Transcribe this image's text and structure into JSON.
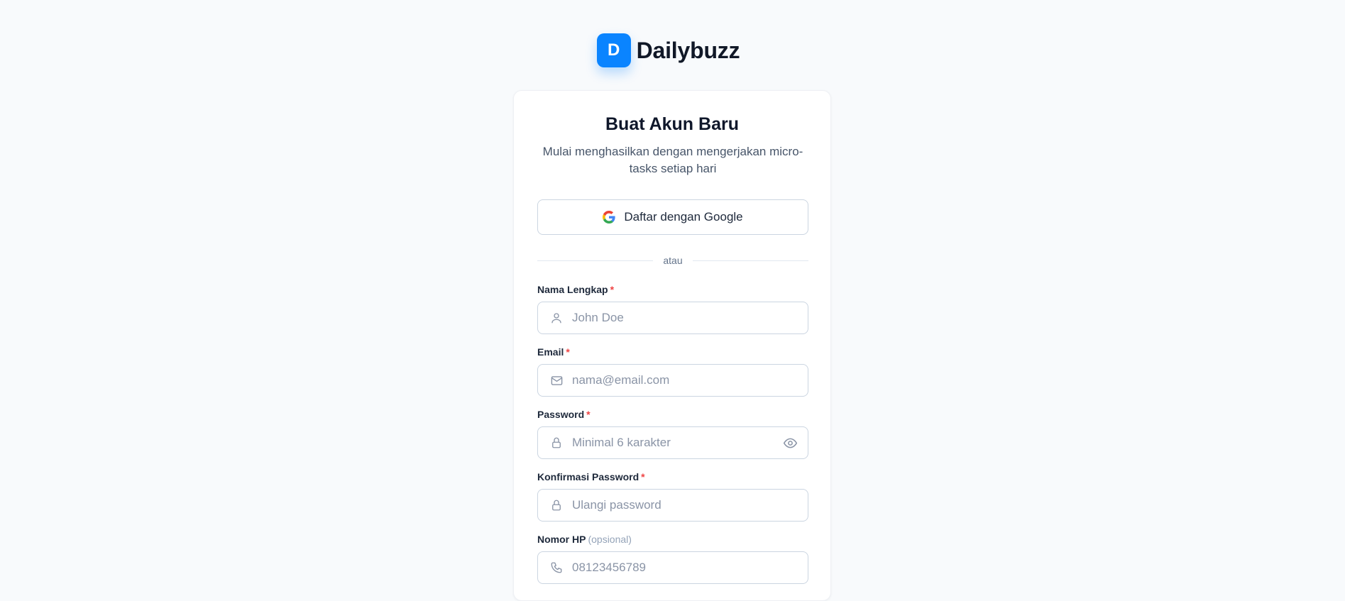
{
  "brand": {
    "logo_letter": "D",
    "name": "Dailybuzz",
    "accent": "#0a84ff"
  },
  "card": {
    "title": "Buat Akun Baru",
    "subtitle": "Mulai menghasilkan dengan mengerjakan micro-tasks setiap hari",
    "google_button": "Daftar dengan Google",
    "divider": "atau"
  },
  "fields": {
    "name": {
      "label": "Nama Lengkap",
      "required": "*",
      "placeholder": "John Doe",
      "value": "",
      "icon": "user-icon"
    },
    "email": {
      "label": "Email",
      "required": "*",
      "placeholder": "nama@email.com",
      "value": "",
      "icon": "mail-icon"
    },
    "password": {
      "label": "Password",
      "required": "*",
      "placeholder": "Minimal 6 karakter",
      "value": "",
      "icon": "lock-icon",
      "toggle_icon": "eye-icon"
    },
    "confirm": {
      "label": "Konfirmasi Password",
      "required": "*",
      "placeholder": "Ulangi password",
      "value": "",
      "icon": "lock-icon"
    },
    "phone": {
      "label": "Nomor HP",
      "optional": "(opsional)",
      "placeholder": "08123456789",
      "value": "",
      "icon": "phone-icon"
    }
  }
}
